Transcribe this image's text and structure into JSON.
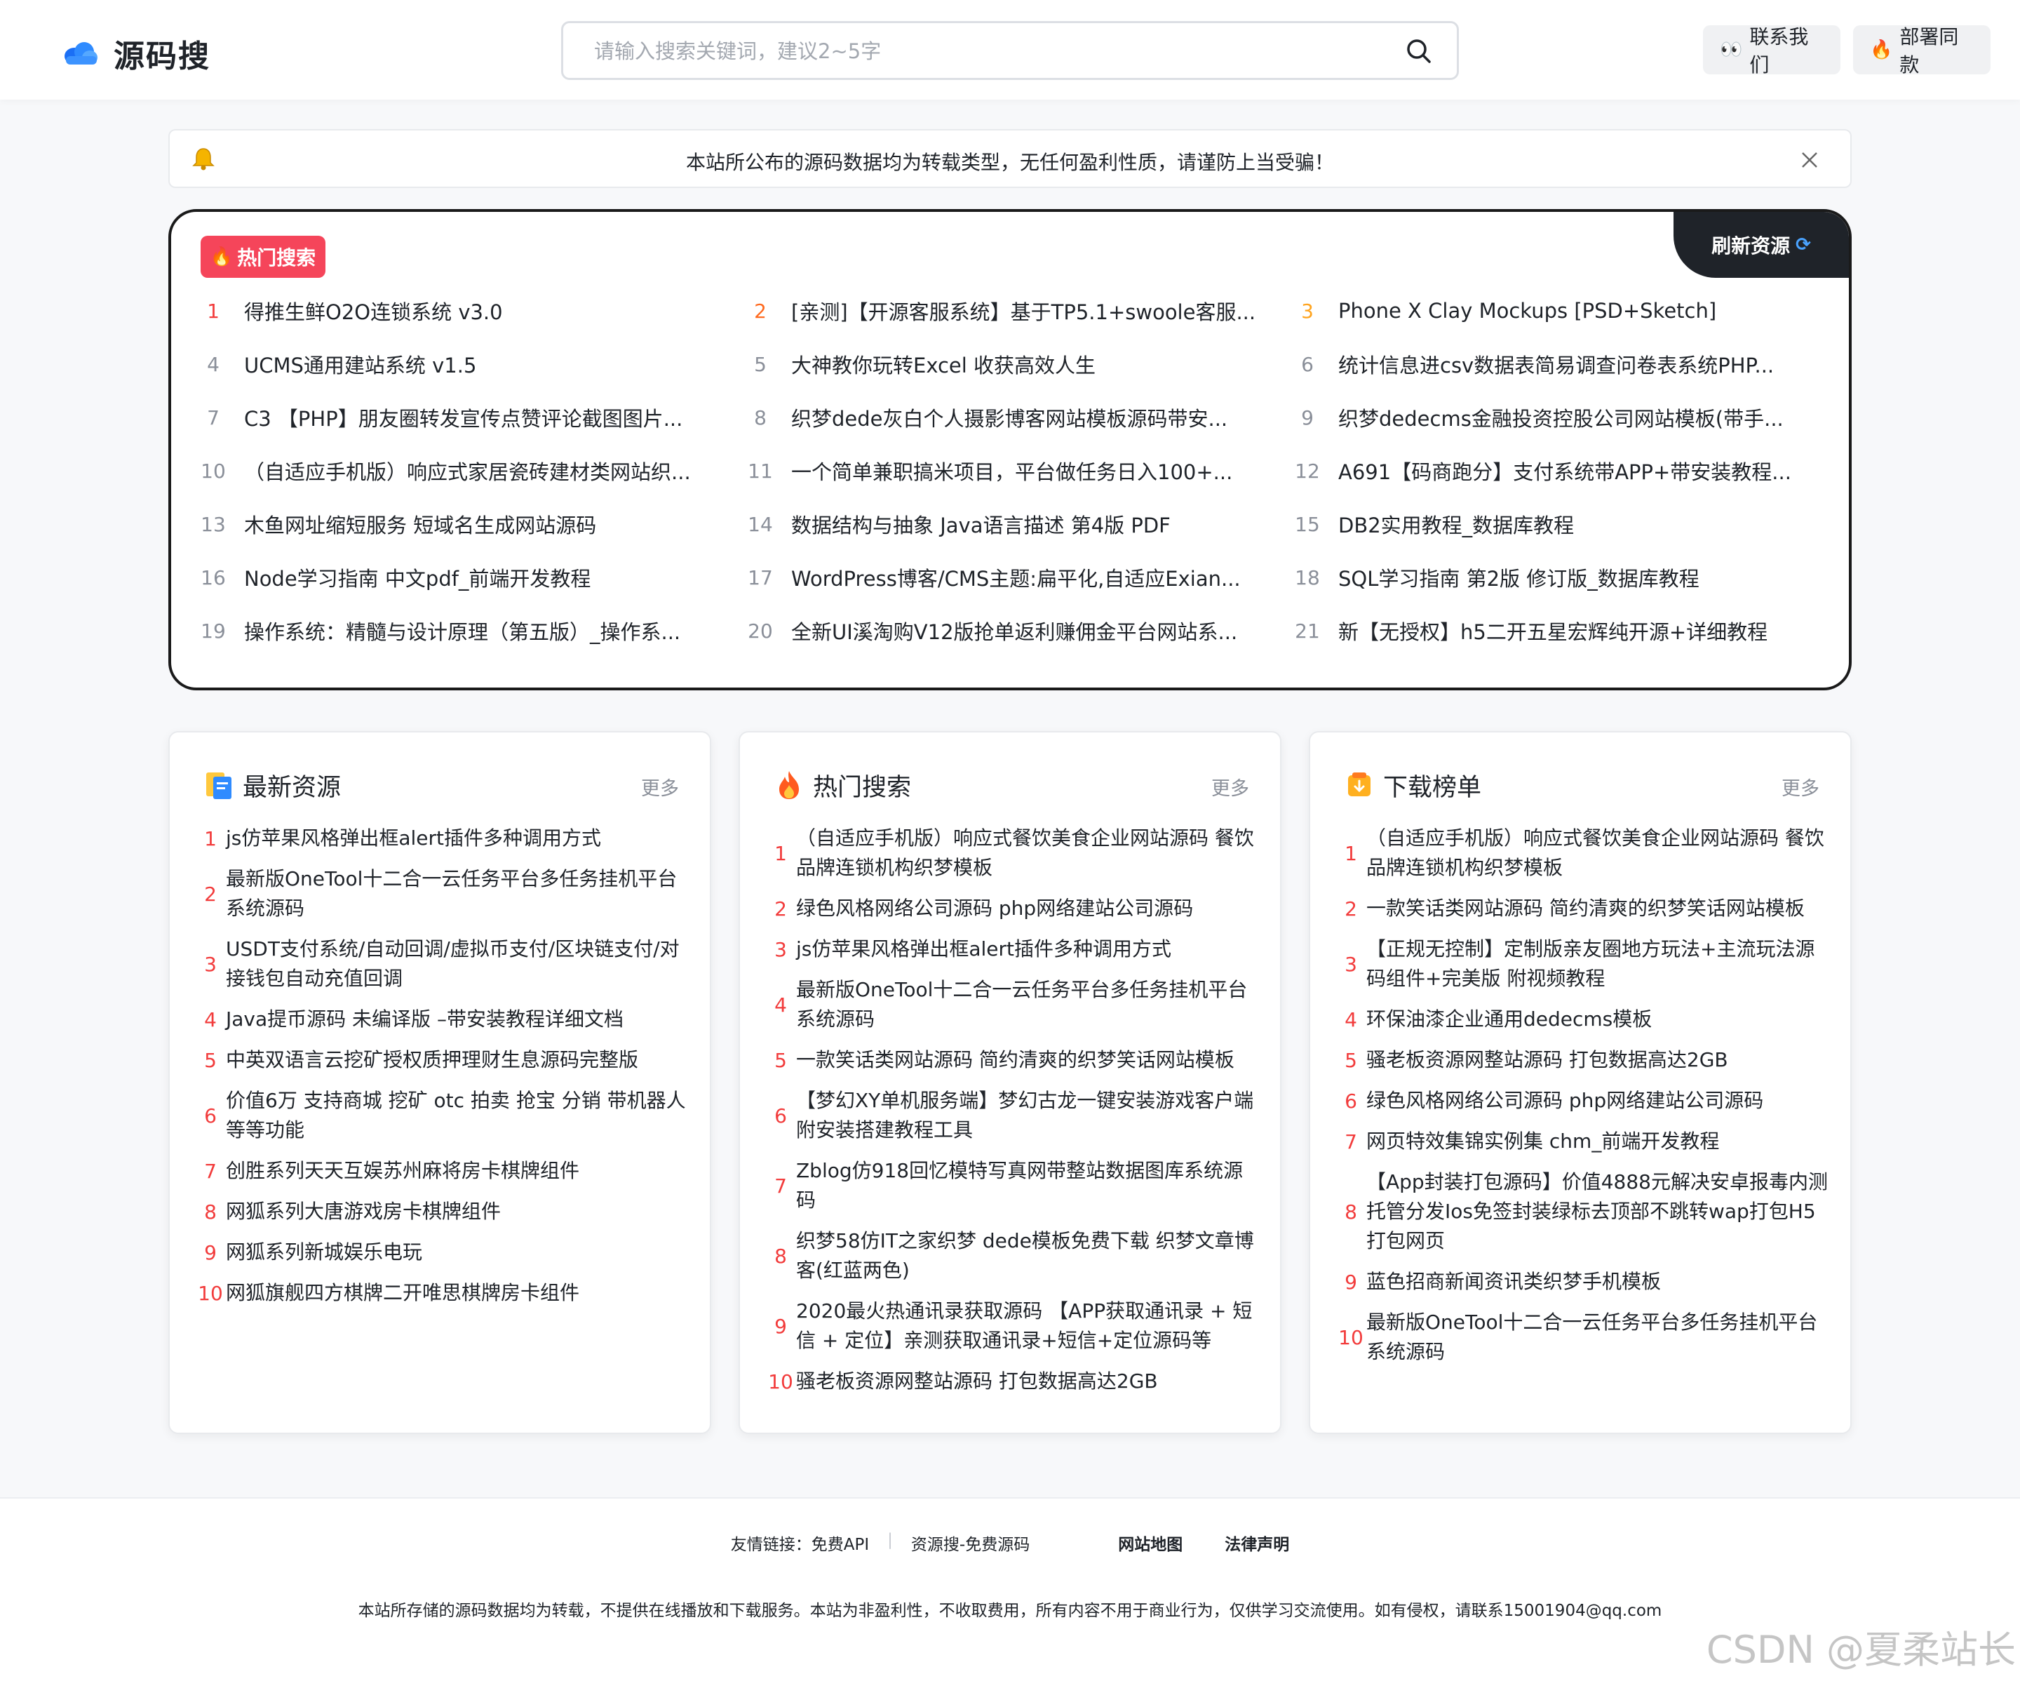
{
  "header": {
    "site_name": "源码搜",
    "search_placeholder": "请输入搜索关键词，建议2~5字",
    "contact_icon": "👀",
    "contact_label": "联系我们",
    "deploy_icon": "🔥",
    "deploy_label": "部署同款"
  },
  "notice": {
    "text": "本站所公布的源码数据均为转载类型，无任何盈利性质，请谨防上当受骗！"
  },
  "hot_panel": {
    "tag": "热门搜索",
    "refresh_label": "刷新资源",
    "items": [
      {
        "num": "1",
        "title": "得推生鲜O2O连锁系统 v3.0"
      },
      {
        "num": "2",
        "title": "[亲测]【开源客服系统】基于TP5.1+swoole客服..."
      },
      {
        "num": "3",
        "title": "Phone X Clay Mockups [PSD+Sketch]"
      },
      {
        "num": "4",
        "title": "UCMS通用建站系统 v1.5"
      },
      {
        "num": "5",
        "title": "大神教你玩转Excel 收获高效人生"
      },
      {
        "num": "6",
        "title": "统计信息进csv数据表简易调查问卷表系统PHP..."
      },
      {
        "num": "7",
        "title": "C3 【PHP】朋友圈转发宣传点赞评论截图图片..."
      },
      {
        "num": "8",
        "title": "织梦dede灰白个人摄影博客网站模板源码带安..."
      },
      {
        "num": "9",
        "title": "织梦dedecms金融投资控股公司网站模板(带手..."
      },
      {
        "num": "10",
        "title": "（自适应手机版）响应式家居瓷砖建材类网站织..."
      },
      {
        "num": "11",
        "title": "一个简单兼职搞米项目，平台做任务日入100+..."
      },
      {
        "num": "12",
        "title": "A691【码商跑分】支付系统带APP+带安装教程..."
      },
      {
        "num": "13",
        "title": "木鱼网址缩短服务 短域名生成网站源码"
      },
      {
        "num": "14",
        "title": "数据结构与抽象 Java语言描述 第4版 PDF"
      },
      {
        "num": "15",
        "title": "DB2实用教程_数据库教程"
      },
      {
        "num": "16",
        "title": "Node学习指南 中文pdf_前端开发教程"
      },
      {
        "num": "17",
        "title": "WordPress博客/CMS主题:扁平化,自适应Exian..."
      },
      {
        "num": "18",
        "title": "SQL学习指南 第2版 修订版_数据库教程"
      },
      {
        "num": "19",
        "title": "操作系统：精髓与设计原理（第五版）_操作系..."
      },
      {
        "num": "20",
        "title": "全新UI溪淘购V12版抢单返利赚佣金平台网站系..."
      },
      {
        "num": "21",
        "title": "新【无授权】h5二开五星宏辉纯开源+详细教程"
      }
    ]
  },
  "cards": {
    "more_label": "更多",
    "latest": {
      "title": "最新资源",
      "items": [
        {
          "num": "1",
          "text": "js仿苹果风格弹出框alert插件多种调用方式"
        },
        {
          "num": "2",
          "text": "最新版OneTool十二合一云任务平台多任务挂机平台系统源码"
        },
        {
          "num": "3",
          "text": "USDT支付系统/自动回调/虚拟币支付/区块链支付/对接钱包自动充值回调"
        },
        {
          "num": "4",
          "text": "Java提币源码 未编译版 –带安装教程详细文档"
        },
        {
          "num": "5",
          "text": "中英双语言云挖矿授权质押理财生息源码完整版"
        },
        {
          "num": "6",
          "text": "价值6万 支持商城 挖矿 otc 拍卖 抢宝 分销 带机器人 等等功能"
        },
        {
          "num": "7",
          "text": "创胜系列天天互娱苏州麻将房卡棋牌组件"
        },
        {
          "num": "8",
          "text": "网狐系列大唐游戏房卡棋牌组件"
        },
        {
          "num": "9",
          "text": "网狐系列新城娱乐电玩"
        },
        {
          "num": "10",
          "text": "网狐旗舰四方棋牌二开唯思棋牌房卡组件"
        }
      ]
    },
    "hot": {
      "title": "热门搜索",
      "items": [
        {
          "num": "1",
          "text": "（自适应手机版）响应式餐饮美食企业网站源码 餐饮品牌连锁机构织梦模板"
        },
        {
          "num": "2",
          "text": "绿色风格网络公司源码 php网络建站公司源码"
        },
        {
          "num": "3",
          "text": "js仿苹果风格弹出框alert插件多种调用方式"
        },
        {
          "num": "4",
          "text": "最新版OneTool十二合一云任务平台多任务挂机平台系统源码"
        },
        {
          "num": "5",
          "text": "一款笑话类网站源码 简约清爽的织梦笑话网站模板"
        },
        {
          "num": "6",
          "text": "【梦幻XY单机服务端】梦幻古龙一键安装游戏客户端附安装搭建教程工具"
        },
        {
          "num": "7",
          "text": "Zblog仿918回忆模特写真网带整站数据图库系统源码"
        },
        {
          "num": "8",
          "text": "织梦58仿IT之家织梦 dede模板免费下载 织梦文章博客(红蓝两色)"
        },
        {
          "num": "9",
          "text": "2020最火热通讯录获取源码 【APP获取通讯录 + 短信 + 定位】亲测获取通讯录+短信+定位源码等"
        },
        {
          "num": "10",
          "text": "骚老板资源网整站源码 打包数据高达2GB"
        }
      ]
    },
    "download": {
      "title": "下载榜单",
      "items": [
        {
          "num": "1",
          "text": "（自适应手机版）响应式餐饮美食企业网站源码 餐饮品牌连锁机构织梦模板"
        },
        {
          "num": "2",
          "text": "一款笑话类网站源码 简约清爽的织梦笑话网站模板"
        },
        {
          "num": "3",
          "text": "【正规无控制】定制版亲友圈地方玩法+主流玩法源码组件+完美版 附视频教程"
        },
        {
          "num": "4",
          "text": "环保油漆企业通用dedecms模板"
        },
        {
          "num": "5",
          "text": "骚老板资源网整站源码 打包数据高达2GB"
        },
        {
          "num": "6",
          "text": "绿色风格网络公司源码 php网络建站公司源码"
        },
        {
          "num": "7",
          "text": "网页特效集锦实例集 chm_前端开发教程"
        },
        {
          "num": "8",
          "text": "【App封装打包源码】价值4888元解决安卓报毒内测托管分发Ios免签封装绿标去顶部不跳转wap打包H5打包网页"
        },
        {
          "num": "9",
          "text": "蓝色招商新闻资讯类织梦手机模板"
        },
        {
          "num": "10",
          "text": "最新版OneTool十二合一云任务平台多任务挂机平台系统源码"
        }
      ]
    }
  },
  "footer": {
    "friend_links": "友情链接：免费API",
    "sep": "|",
    "link2": "资源搜-免费源码",
    "sitemap": "网站地图",
    "legal": "法律声明",
    "disclaimer": "本站所存储的源码数据均为转载，不提供在线播放和下载服务。本站为非盈利性，不收取费用，所有内容不用于商业行为，仅供学习交流使用。如有侵权，请联系15001904@qq.com",
    "watermark": "CSDN @夏柔站长"
  }
}
